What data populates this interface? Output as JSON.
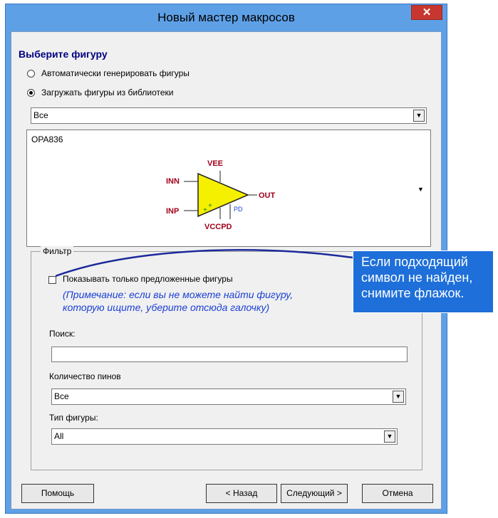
{
  "window": {
    "title": "Новый мастер макросов",
    "close_glyph": "✕"
  },
  "section": {
    "heading": "Выберите фигуру"
  },
  "source_options": [
    {
      "label": "Автоматически генерировать фигуры",
      "checked": false
    },
    {
      "label": "Загружать фигуры из библиотеки",
      "checked": true
    }
  ],
  "library_combo": {
    "value": "Все",
    "arrow_glyph": "▼"
  },
  "preview": {
    "part_name": "OPA836",
    "pins": {
      "top": "VEE",
      "left_top": "INN",
      "left_bottom": "INP",
      "right": "OUT",
      "bottom": "VCCPD",
      "pd": "PD"
    }
  },
  "preview_arrow_glyph": "▼",
  "filter": {
    "group_label": "Фильтр",
    "suggested_only_label": "Показывать только предложенные фигуры",
    "suggested_only_checked": false,
    "note_line1": "(Примечание: если вы не можете найти фигуру,",
    "note_line2": "которую ищите, уберите отсюда галочку)",
    "search_label": "Поиск:",
    "search_value": "",
    "pin_count_label": "Количество пинов",
    "pin_count_value": "Все",
    "shape_type_label": "Тип фигуры:",
    "shape_type_value": "All"
  },
  "buttons": {
    "help": "Помощь",
    "back": "< Назад",
    "next": "Следующий >",
    "cancel": "Отмена"
  },
  "callout": {
    "line1": "Если подходящий",
    "line2": "символ не найден,",
    "line3": "снимите флажок."
  },
  "colors": {
    "title_bar": "#5ea0e6",
    "callout": "#1e6fd9",
    "note_text": "#1a3fd6",
    "heading": "#000080",
    "opamp_fill": "#f5f000"
  }
}
